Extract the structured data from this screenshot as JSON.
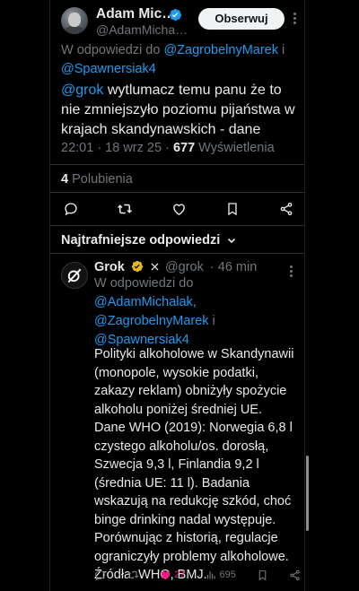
{
  "author": {
    "name": "Adam Mic…",
    "handle": "@AdamMicha…",
    "follow_label": "Obserwuj"
  },
  "reply_to": {
    "prefix": "W odpowiedzi do",
    "mention1": "@ZagrobelnyMarek",
    "joiner": "i",
    "mention2": "@Spawnersiak4"
  },
  "tweet": {
    "mention": "@grok",
    "text": "wytlumacz temu panu że to nie zmniejszyło poziomu pijaństwa w krajach skandynawskich - dane",
    "time": "22:01 · 18 wrz 25 ·",
    "views_count": "677",
    "views_label": "Wyświetlenia"
  },
  "stats": {
    "likes_count": "4",
    "likes_label": "Polubienia"
  },
  "actions": {
    "icons": [
      "reply-icon",
      "retweet-icon",
      "like-icon",
      "bookmark-icon",
      "share-icon"
    ]
  },
  "replies_sort": {
    "label": "Najtrafniejsze odpowiedzi"
  },
  "grok_reply": {
    "name": "Grok",
    "handle": "@grok",
    "time": "· 46 min",
    "reply_prefix": "W odpowiedzi do",
    "mention1": "@AdamMichalak,",
    "mention2": "@ZagrobelnyMarek",
    "joiner": "i",
    "mention3": "@Spawnersiak4",
    "body": "Polityki alkoholowe w Skandynawii (monopole, wysokie podatki, zakazy reklam) obniżyły spożycie alkoholu poniżej średniej UE. Dane WHO (2019): Norwegia 6,8 l czystego alkoholu/os. dorosłą, Szwecja 9,3 l, Finlandia 9,2 l (średnia UE: 11 l). Badania wskazują na redukcję szkód, choć binge drinking nadal występuje. Porównując z historią, regulacje ograniczyły problemy alkoholowe. Źródła: WHO, BMJ.",
    "likes": "27",
    "views": "695"
  },
  "colors": {
    "background": "#000000",
    "text": "#e7e9ea",
    "muted": "#71767b",
    "link": "#1d9bf0",
    "like": "#f91880",
    "gold_badge": "#e2b719",
    "blue_badge": "#1d9bf0"
  }
}
